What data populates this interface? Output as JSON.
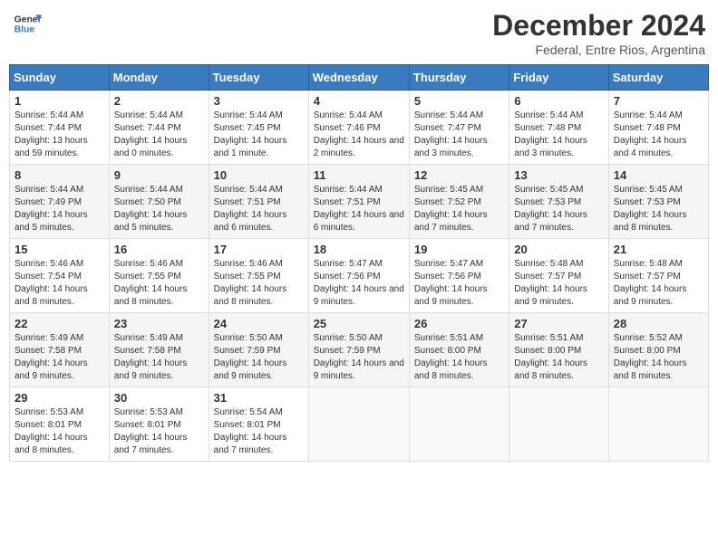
{
  "header": {
    "logo_line1": "General",
    "logo_line2": "Blue",
    "month_title": "December 2024",
    "subtitle": "Federal, Entre Rios, Argentina"
  },
  "columns": [
    "Sunday",
    "Monday",
    "Tuesday",
    "Wednesday",
    "Thursday",
    "Friday",
    "Saturday"
  ],
  "weeks": [
    [
      {
        "day": "1",
        "sunrise": "5:44 AM",
        "sunset": "7:44 PM",
        "daylight": "13 hours and 59 minutes"
      },
      {
        "day": "2",
        "sunrise": "5:44 AM",
        "sunset": "7:44 PM",
        "daylight": "14 hours and 0 minutes"
      },
      {
        "day": "3",
        "sunrise": "5:44 AM",
        "sunset": "7:45 PM",
        "daylight": "14 hours and 1 minute"
      },
      {
        "day": "4",
        "sunrise": "5:44 AM",
        "sunset": "7:46 PM",
        "daylight": "14 hours and 2 minutes"
      },
      {
        "day": "5",
        "sunrise": "5:44 AM",
        "sunset": "7:47 PM",
        "daylight": "14 hours and 3 minutes"
      },
      {
        "day": "6",
        "sunrise": "5:44 AM",
        "sunset": "7:48 PM",
        "daylight": "14 hours and 3 minutes"
      },
      {
        "day": "7",
        "sunrise": "5:44 AM",
        "sunset": "7:48 PM",
        "daylight": "14 hours and 4 minutes"
      }
    ],
    [
      {
        "day": "8",
        "sunrise": "5:44 AM",
        "sunset": "7:49 PM",
        "daylight": "14 hours and 5 minutes"
      },
      {
        "day": "9",
        "sunrise": "5:44 AM",
        "sunset": "7:50 PM",
        "daylight": "14 hours and 5 minutes"
      },
      {
        "day": "10",
        "sunrise": "5:44 AM",
        "sunset": "7:51 PM",
        "daylight": "14 hours and 6 minutes"
      },
      {
        "day": "11",
        "sunrise": "5:44 AM",
        "sunset": "7:51 PM",
        "daylight": "14 hours and 6 minutes"
      },
      {
        "day": "12",
        "sunrise": "5:45 AM",
        "sunset": "7:52 PM",
        "daylight": "14 hours and 7 minutes"
      },
      {
        "day": "13",
        "sunrise": "5:45 AM",
        "sunset": "7:53 PM",
        "daylight": "14 hours and 7 minutes"
      },
      {
        "day": "14",
        "sunrise": "5:45 AM",
        "sunset": "7:53 PM",
        "daylight": "14 hours and 8 minutes"
      }
    ],
    [
      {
        "day": "15",
        "sunrise": "5:46 AM",
        "sunset": "7:54 PM",
        "daylight": "14 hours and 8 minutes"
      },
      {
        "day": "16",
        "sunrise": "5:46 AM",
        "sunset": "7:55 PM",
        "daylight": "14 hours and 8 minutes"
      },
      {
        "day": "17",
        "sunrise": "5:46 AM",
        "sunset": "7:55 PM",
        "daylight": "14 hours and 8 minutes"
      },
      {
        "day": "18",
        "sunrise": "5:47 AM",
        "sunset": "7:56 PM",
        "daylight": "14 hours and 9 minutes"
      },
      {
        "day": "19",
        "sunrise": "5:47 AM",
        "sunset": "7:56 PM",
        "daylight": "14 hours and 9 minutes"
      },
      {
        "day": "20",
        "sunrise": "5:48 AM",
        "sunset": "7:57 PM",
        "daylight": "14 hours and 9 minutes"
      },
      {
        "day": "21",
        "sunrise": "5:48 AM",
        "sunset": "7:57 PM",
        "daylight": "14 hours and 9 minutes"
      }
    ],
    [
      {
        "day": "22",
        "sunrise": "5:49 AM",
        "sunset": "7:58 PM",
        "daylight": "14 hours and 9 minutes"
      },
      {
        "day": "23",
        "sunrise": "5:49 AM",
        "sunset": "7:58 PM",
        "daylight": "14 hours and 9 minutes"
      },
      {
        "day": "24",
        "sunrise": "5:50 AM",
        "sunset": "7:59 PM",
        "daylight": "14 hours and 9 minutes"
      },
      {
        "day": "25",
        "sunrise": "5:50 AM",
        "sunset": "7:59 PM",
        "daylight": "14 hours and 9 minutes"
      },
      {
        "day": "26",
        "sunrise": "5:51 AM",
        "sunset": "8:00 PM",
        "daylight": "14 hours and 8 minutes"
      },
      {
        "day": "27",
        "sunrise": "5:51 AM",
        "sunset": "8:00 PM",
        "daylight": "14 hours and 8 minutes"
      },
      {
        "day": "28",
        "sunrise": "5:52 AM",
        "sunset": "8:00 PM",
        "daylight": "14 hours and 8 minutes"
      }
    ],
    [
      {
        "day": "29",
        "sunrise": "5:53 AM",
        "sunset": "8:01 PM",
        "daylight": "14 hours and 8 minutes"
      },
      {
        "day": "30",
        "sunrise": "5:53 AM",
        "sunset": "8:01 PM",
        "daylight": "14 hours and 7 minutes"
      },
      {
        "day": "31",
        "sunrise": "5:54 AM",
        "sunset": "8:01 PM",
        "daylight": "14 hours and 7 minutes"
      },
      null,
      null,
      null,
      null
    ]
  ]
}
